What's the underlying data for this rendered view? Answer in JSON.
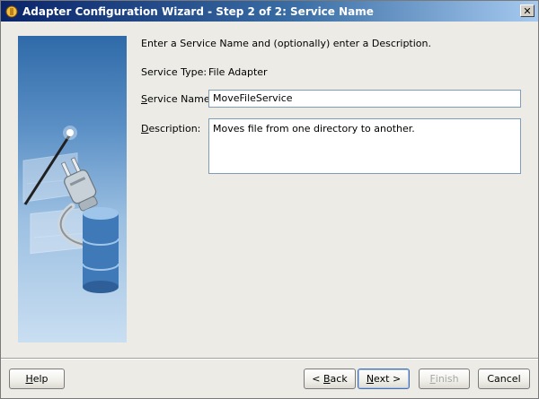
{
  "window": {
    "title": "Adapter Configuration Wizard - Step 2 of 2: Service Name",
    "close_glyph": "✕"
  },
  "form": {
    "instruction": "Enter a Service Name and (optionally) enter a Description.",
    "service_type_label": "Service Type:",
    "service_type_value": "File Adapter",
    "service_name_label_first": "S",
    "service_name_label_rest": "ervice Name:",
    "service_name_value": "MoveFileService",
    "description_label_first": "D",
    "description_label_rest": "escription:",
    "description_value": "Moves file from one directory to another."
  },
  "buttons": {
    "help_first": "H",
    "help_rest": "elp",
    "back_prefix": "< ",
    "back_first": "B",
    "back_rest": "ack",
    "next_first": "N",
    "next_rest": "ext >",
    "finish_first": "F",
    "finish_rest": "inish",
    "cancel": "Cancel"
  },
  "icons": {
    "title_icon": "adapter-wizard-icon",
    "side_image": "plug-and-database-illustration"
  },
  "colors": {
    "title_start": "#0a246a",
    "title_end": "#a6caf0",
    "panel_top": "#2f6aa8",
    "field_border": "#7f9db9"
  }
}
